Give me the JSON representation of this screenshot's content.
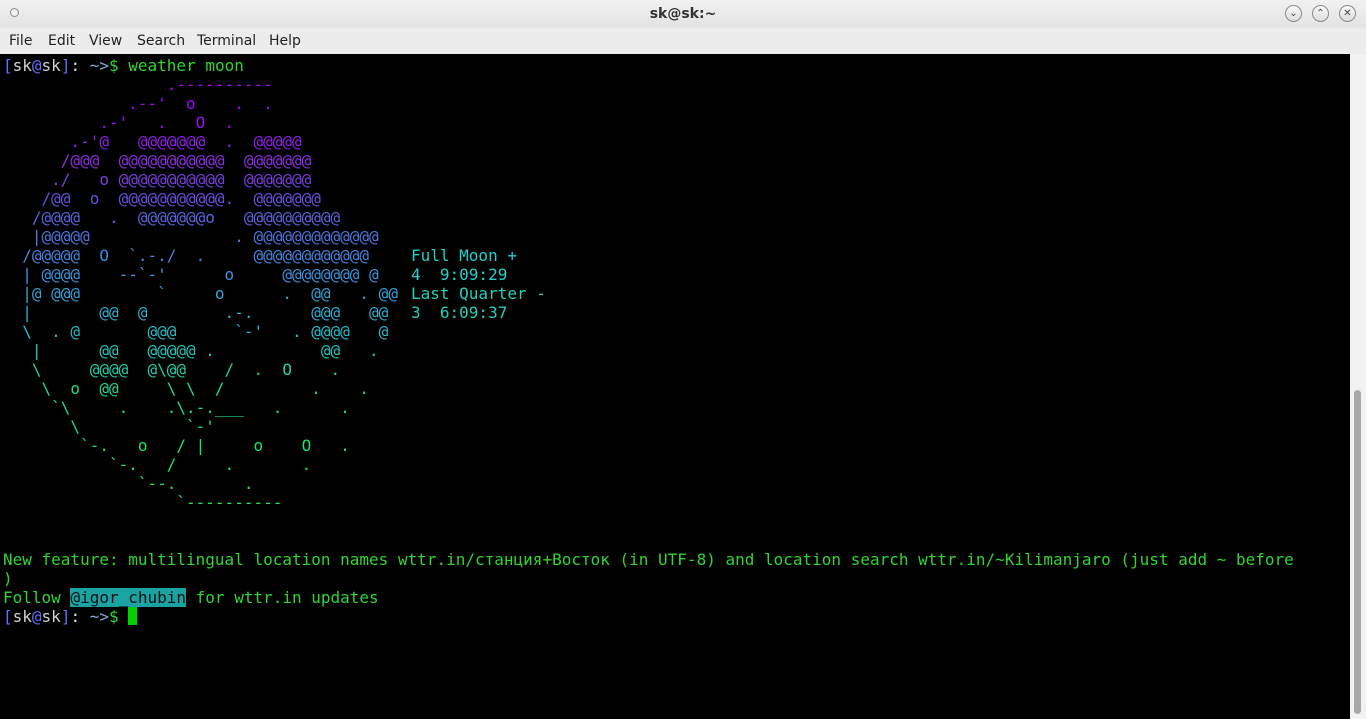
{
  "window": {
    "title": "sk@sk:~",
    "minimize_glyph": "⌄",
    "maximize_glyph": "⌃",
    "close_glyph": "✕"
  },
  "menu": {
    "items": [
      "File",
      "Edit",
      "View",
      "Search",
      "Terminal",
      "Help"
    ]
  },
  "prompt": {
    "open_bracket": "[",
    "user": "sk",
    "at": "@",
    "host": "sk",
    "close_bracket": "]",
    "colon": ": ",
    "path": "~",
    "arrow": ">",
    "dollar": "$ "
  },
  "command": "weather moon",
  "moon": {
    "phase_1": "Full Moon +",
    "phase_1_time": "4  9:09:29",
    "phase_2": "Last Quarter -",
    "phase_2_time": "3  6:09:37",
    "lines": [
      {
        "t": "                 .----------",
        "c": "#b000ff"
      },
      {
        "t": "             .--'  o    .  .",
        "c": "#a100ff"
      },
      {
        "t": "          .-'   .   O  .",
        "c": "#9a10f0"
      },
      {
        "t": "       .-'@   @@@@@@@  .  @@@@@",
        "c": "#8f20e8"
      },
      {
        "t": "      /@@@  @@@@@@@@@@@  @@@@@@@",
        "c": "#8a2fe0"
      },
      {
        "t": "     ./   o @@@@@@@@@@@  @@@@@@@",
        "c": "#7a3ee0"
      },
      {
        "t": "    /@@  o  @@@@@@@@@@@.  @@@@@@@",
        "c": "#6c4fe0"
      },
      {
        "t": "   /@@@@   .  @@@@@@@o   @@@@@@@@@@",
        "c": "#5c63e0"
      },
      {
        "t": "   |@@@@@               . @@@@@@@@@@@@@",
        "c": "#4e76e0"
      },
      {
        "t": "  /@@@@@  O  `.-./  .     @@@@@@@@@@@@",
        "c": "#4485e0"
      },
      {
        "t": "  | @@@@    --`-'      o     @@@@@@@@ @",
        "c": "#3a95e0"
      },
      {
        "t": "  |@ @@@        `     o      .  @@   . @@",
        "c": "#33a3d8"
      },
      {
        "t": "  |       @@  @        .-.      @@@   @@",
        "c": "#2cb0d0"
      },
      {
        "t": "  \\  . @       @@@      `-'   . @@@@   @",
        "c": "#26bcc8"
      },
      {
        "t": "   |      @@   @@@@@ .           @@   .",
        "c": "#20c6bc"
      },
      {
        "t": "   \\     @@@@  @\\@@    /  .  O    .",
        "c": "#1ccfaa"
      },
      {
        "t": "    \\  o  @@     \\ \\  /         .    .",
        "c": "#1ad69a"
      },
      {
        "t": "     `\\     .    .\\.-.___   .      .",
        "c": "#18dc8a"
      },
      {
        "t": "       \\           `-'",
        "c": "#18e07a"
      },
      {
        "t": "        `-.   o   / |     o    O   .",
        "c": "#1ae26c"
      },
      {
        "t": "           `-.   /     .       .",
        "c": "#1ce460"
      },
      {
        "t": "              `--.       .",
        "c": "#20e656"
      },
      {
        "t": "                  `----------",
        "c": "#24e84e"
      }
    ]
  },
  "feature_line": "New feature: multilingual location names wttr.in/станция+Восток (in UTF-8) and location search wttr.in/~Kilimanjaro (just add ~ before",
  "feature_line_wrap": ")",
  "follow": {
    "prefix": "Follow ",
    "handle": "@igor_chubin",
    "suffix": " for wttr.in updates"
  }
}
